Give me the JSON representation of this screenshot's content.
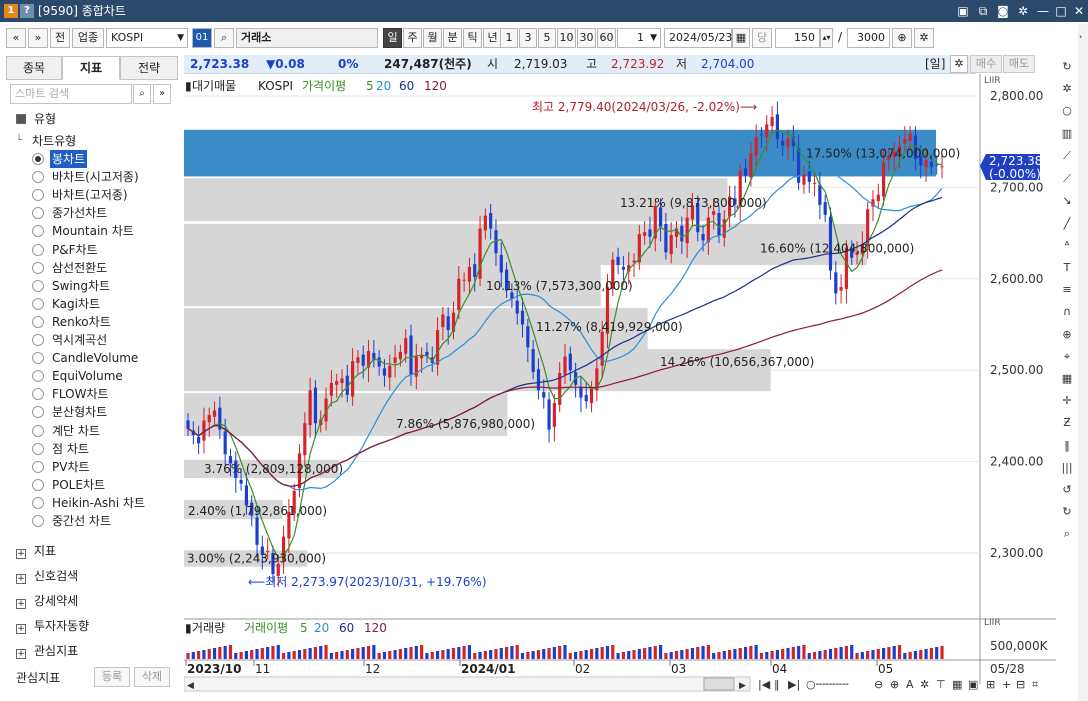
{
  "window": {
    "icon1": "1",
    "icon2": "?",
    "title": "[9590] 종합차트"
  },
  "toolbar": {
    "nav_prev": "«",
    "nav_down": "»",
    "btn_all": "전",
    "btn_sector": "업종",
    "symbol": "KOSPI",
    "code_badge": "01",
    "exchange": "거래소",
    "periods": [
      "일",
      "주",
      "월",
      "분",
      "틱",
      "년"
    ],
    "active_period": "일",
    "intervals": [
      "1",
      "3",
      "5",
      "10",
      "30",
      "60"
    ],
    "interval_value": "1",
    "date": "2024/05/23",
    "btn_today": "당",
    "count": "150",
    "slash": "/",
    "total": "3000"
  },
  "left_panel": {
    "tabs": [
      "종목",
      "지표",
      "전략"
    ],
    "active_tab": "지표",
    "search_placeholder": "스마트 검색",
    "section_type": "유형",
    "chart_type_group": "차트유형",
    "chart_types": [
      "봉차트",
      "바차트(시고저종)",
      "바차트(고저종)",
      "종가선차트",
      "Mountain 차트",
      "P&F차트",
      "삼선전환도",
      "Swing차트",
      "Kagi차트",
      "Renko차트",
      "역시계곡선",
      "CandleVolume",
      "EquiVolume",
      "FLOW차트",
      "분산형차트",
      "계단 차트",
      "점 차트",
      "PV차트",
      "POLE차트",
      "Heikin-Ashi 차트",
      "중간선 차트"
    ],
    "selected_type": "봉차트",
    "groups": [
      "지표",
      "신호검색",
      "강세약세",
      "투자자동향",
      "관심지표"
    ],
    "footer_label": "관심지표",
    "footer_register": "등록",
    "footer_delete": "삭제"
  },
  "infobar": {
    "price": "2,723.38",
    "change": "▼0.08",
    "change_pct": "0%",
    "volume": "247,487(천주)",
    "open_label": "시",
    "open": "2,719.03",
    "high_label": "고",
    "high": "2,723.92",
    "low_label": "저",
    "low": "2,704.00",
    "period_tag": "[일]",
    "buy": "매수",
    "sell": "매도"
  },
  "chart": {
    "legend_main": [
      "대기매물",
      "KOSPI",
      "가격이평",
      "5",
      "20",
      "60",
      "120"
    ],
    "legend_volume": [
      "거래량",
      "거래이평",
      "5",
      "20",
      "60",
      "120"
    ],
    "high_annotation": "최고 2,779.40(2024/03/26, -2.02%)",
    "low_annotation": "최저 2,273.97(2023/10/31, +19.76%)",
    "current_price_tag": "2,723.38",
    "current_pct_tag": "(-0.00%)",
    "volume_axis_label": "500,000K",
    "last_date_label": "05/28",
    "corner_tag": "LIIR",
    "colors": {
      "ma5": "#3a8f2a",
      "ma20": "#2b8fd6",
      "ma60": "#1b2f8c",
      "ma120": "#8a1c3a",
      "up": "#d4232a",
      "down": "#1a3fcf",
      "band_highlight": "#3b8bc6",
      "band_gray": "#d4d4d4"
    }
  },
  "chart_data": {
    "type": "candlestick",
    "title": "",
    "symbol": "KOSPI",
    "ylim": [
      2250,
      2830
    ],
    "y_ticks": [
      "2,800.00",
      "2,700.00",
      "2,600.00",
      "2,500.00",
      "2,400.00",
      "2,300.00"
    ],
    "y_tick_values": [
      2800,
      2700,
      2600,
      2500,
      2400,
      2300
    ],
    "x_ticks": [
      "2023/10",
      "11",
      "12",
      "2024/01",
      "02",
      "03",
      "04",
      "05"
    ],
    "volume_profile": [
      {
        "low": 2285,
        "high": 2303,
        "label": "3.00% (2,243,930,000)"
      },
      {
        "low": 2337,
        "high": 2358,
        "label": "2.40% (1,792,861,000)"
      },
      {
        "low": 2382,
        "high": 2402,
        "label": "3.76% (2,809,128,000)"
      },
      {
        "low": 2428,
        "high": 2475,
        "label": "7.86% (5,876,980,000)"
      },
      {
        "low": 2477,
        "high": 2523,
        "label": "14.26% (10,656,367,000)"
      },
      {
        "low": 2522,
        "high": 2568,
        "label": "11.27% (8,419,929,000)"
      },
      {
        "low": 2570,
        "high": 2615,
        "label": "10.13% (7,573,300,000)"
      },
      {
        "low": 2615,
        "high": 2660,
        "label": "16.60% (12,404,800,000)"
      },
      {
        "low": 2663,
        "high": 2710,
        "label": "13.21% (9,873,800,000)"
      },
      {
        "low": 2712,
        "high": 2763,
        "label": "17.50% (13,074,000,000)",
        "highlight": true
      }
    ],
    "high": {
      "value": 2779.4,
      "date": "2024/03/26",
      "pct": -2.02
    },
    "low": {
      "value": 2273.97,
      "date": "2023/10/31",
      "pct": 19.76
    },
    "series": [
      {
        "name": "KOSPI",
        "x_range": [
          "2023/10/04",
          "2024/05/23"
        ],
        "close": [
          2436,
          2429,
          2420,
          2445,
          2451,
          2456,
          2435,
          2408,
          2398,
          2382,
          2376,
          2352,
          2341,
          2309,
          2298,
          2302,
          2277,
          2288,
          2318,
          2345,
          2368,
          2409,
          2442,
          2478,
          2442,
          2446,
          2469,
          2486,
          2488,
          2491,
          2473,
          2510,
          2514,
          2505,
          2521,
          2511,
          2504,
          2494,
          2505,
          2514,
          2520,
          2535,
          2495,
          2515,
          2517,
          2516,
          2508,
          2544,
          2561,
          2544,
          2563,
          2600,
          2599,
          2613,
          2602,
          2655,
          2669,
          2655,
          2628,
          2607,
          2587,
          2578,
          2562,
          2550,
          2525,
          2498,
          2478,
          2470,
          2435,
          2464,
          2497,
          2515,
          2500,
          2484,
          2470,
          2466,
          2480,
          2502,
          2542,
          2591,
          2621,
          2615,
          2610,
          2615,
          2620,
          2649,
          2651,
          2646,
          2680,
          2657,
          2629,
          2648,
          2655,
          2641,
          2667,
          2680,
          2651,
          2642,
          2667,
          2674,
          2647,
          2665,
          2690,
          2681,
          2718,
          2713,
          2737,
          2755,
          2757,
          2769,
          2777,
          2753,
          2746,
          2753,
          2745,
          2705,
          2716,
          2706,
          2705,
          2681,
          2670,
          2609,
          2584,
          2591,
          2634,
          2623,
          2629,
          2638,
          2676,
          2687,
          2692,
          2727,
          2735,
          2739,
          2745,
          2753,
          2759,
          2731,
          2724,
          2730,
          2722,
          2724,
          2723
        ]
      }
    ],
    "volume_ylim": [
      0,
      1000000
    ],
    "volume_tick": "500,000K"
  }
}
